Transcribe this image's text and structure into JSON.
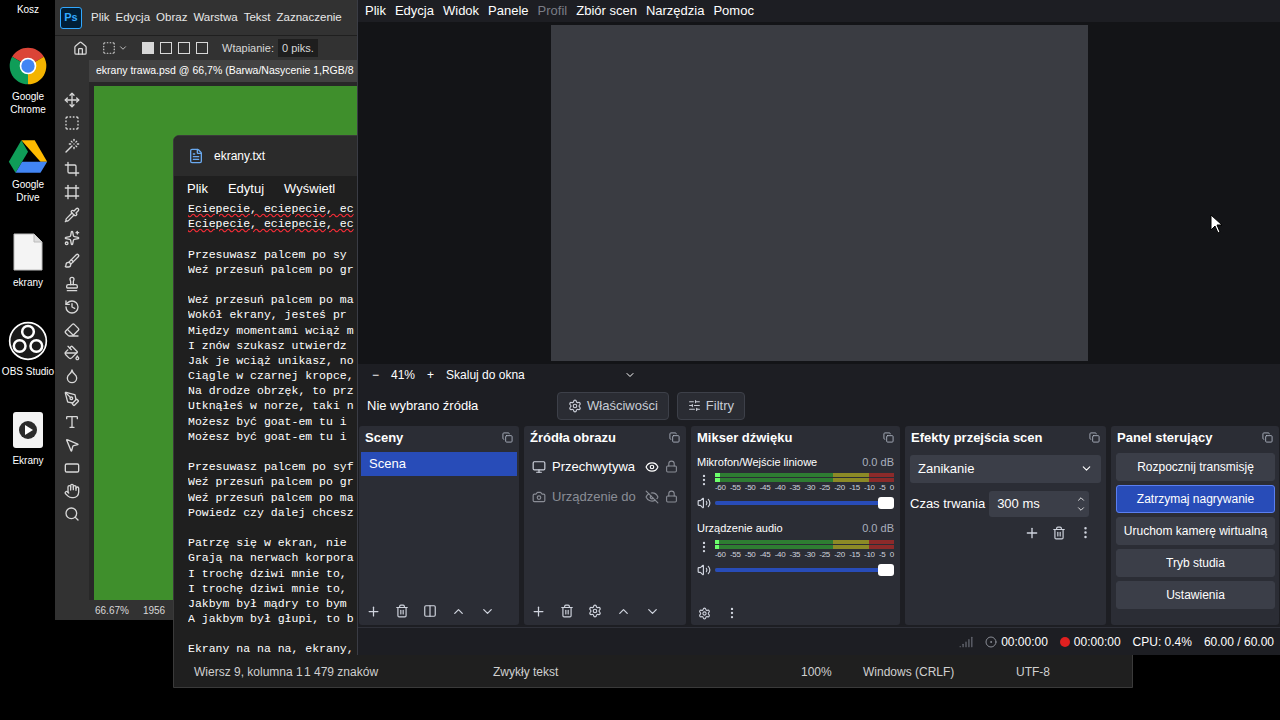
{
  "desktop": {
    "icons": [
      {
        "label": "Kosz"
      },
      {
        "label": "Google Chrome"
      },
      {
        "label": "Google Drive"
      },
      {
        "label": "ekrany"
      },
      {
        "label": "OBS Studio"
      },
      {
        "label": "Ekrany"
      }
    ]
  },
  "photoshop": {
    "logo": "Ps",
    "menu": [
      "Plik",
      "Edycja",
      "Obraz",
      "Warstwa",
      "Tekst",
      "Zaznaczenie"
    ],
    "options": {
      "feather_label": "Wtapianie:",
      "feather_value": "0 piks."
    },
    "document_tab": "ekrany trawa.psd @ 66,7% (Barwa/Nasycenie 1,RGB/8",
    "status": {
      "zoom": "66.67%",
      "size": "1956"
    }
  },
  "notepad": {
    "title": "ekrany.txt",
    "menu": [
      "Plik",
      "Edytuj",
      "Wyświetl"
    ],
    "lines": [
      {
        "text": "Eciepecie, eciepecie, ec",
        "misspelled": true
      },
      {
        "text": "Eciepecie, eciepecie, ec",
        "misspelled": true
      },
      {
        "text": "",
        "misspelled": false
      },
      {
        "text": "Przesuwasz palcem po sy",
        "misspelled": false
      },
      {
        "text": "Weź przesuń palcem po gr",
        "misspelled": false
      },
      {
        "text": "",
        "misspelled": false
      },
      {
        "text": "Weź przesuń palcem po ma",
        "misspelled": false
      },
      {
        "text": "Wokół ekrany, jesteś pr",
        "misspelled": false
      },
      {
        "text": "Między momentami wciąż m",
        "misspelled": false
      },
      {
        "text": "I znów szukasz utwierdz",
        "misspelled": false
      },
      {
        "text": "Jak je wciąż unikasz, no",
        "misspelled": false
      },
      {
        "text": "Ciągle w czarnej kropce,",
        "misspelled": false
      },
      {
        "text": "Na drodze obrzęk, to prz",
        "misspelled": false
      },
      {
        "text": "Utknąłeś w norze, taki n",
        "misspelled": false
      },
      {
        "text": "Możesz być goat-em tu i",
        "misspelled": false
      },
      {
        "text": "Możesz być goat-em tu i",
        "misspelled": false
      },
      {
        "text": "",
        "misspelled": false
      },
      {
        "text": "Przesuwasz palcem po syf",
        "misspelled": false
      },
      {
        "text": "Weź przesuń palcem po gr",
        "misspelled": false
      },
      {
        "text": "Weź przesuń palcem po ma",
        "misspelled": false
      },
      {
        "text": "Powiedz czy dalej chcesz",
        "misspelled": false
      },
      {
        "text": "",
        "misspelled": false
      },
      {
        "text": "Patrzę się w ekran, nie",
        "misspelled": false
      },
      {
        "text": "Grają na nerwach korpora",
        "misspelled": false
      },
      {
        "text": "I trochę dziwi mnie to,",
        "misspelled": false
      },
      {
        "text": "I trochę dziwi mnie to,",
        "misspelled": false
      },
      {
        "text": "Jakbym był mądry to bym",
        "misspelled": false
      },
      {
        "text": "A jakbym był głupi, to b",
        "misspelled": false
      },
      {
        "text": "",
        "misspelled": false
      },
      {
        "text": "Ekrany na na na, ekrany,",
        "misspelled": false
      }
    ],
    "status_bar": [
      "Wiersz 9, kolumna 1",
      "1 479 znaków",
      "Zwykły tekst",
      "100%",
      "Windows (CRLF)",
      "UTF-8"
    ]
  },
  "obs": {
    "menu": [
      {
        "label": "Plik",
        "disabled": false
      },
      {
        "label": "Edycja",
        "disabled": false
      },
      {
        "label": "Widok",
        "disabled": false
      },
      {
        "label": "Panele",
        "disabled": false
      },
      {
        "label": "Profil",
        "disabled": true
      },
      {
        "label": "Zbiór scen",
        "disabled": false
      },
      {
        "label": "Narzędzia",
        "disabled": false
      },
      {
        "label": "Pomoc",
        "disabled": false
      }
    ],
    "zoom_bar": {
      "minus": "−",
      "value": "41%",
      "plus": "+",
      "scale": "Skaluj do okna"
    },
    "source_bar": {
      "label": "Nie wybrano źródła",
      "buttons": [
        "Właściwości",
        "Filtry"
      ]
    },
    "scenes": {
      "title": "Sceny",
      "items": [
        {
          "label": "Scena",
          "selected": true
        }
      ]
    },
    "sources": {
      "title": "Źródła obrazu",
      "items": [
        {
          "label": "Przechwytywa",
          "visible": true,
          "kind": "screen"
        },
        {
          "label": "Urządzenie do",
          "visible": false,
          "kind": "camera"
        }
      ]
    },
    "mixer": {
      "title": "Mikser dźwięku",
      "scale": [
        "-60",
        "-55",
        "-50",
        "-45",
        "-40",
        "-35",
        "-30",
        "-25",
        "-20",
        "-15",
        "-10",
        "-5",
        "0"
      ],
      "channels": [
        {
          "name": "Mikrofon/Wejście liniowe",
          "reading": "0.0 dB",
          "meter": {
            "level": 0.03
          },
          "volume": {
            "level": 1
          }
        },
        {
          "name": "Urządzenie audio",
          "reading": "0.0 dB",
          "meter": {
            "level": 0.02
          },
          "volume": {
            "level": 1
          }
        }
      ]
    },
    "transitions": {
      "title": "Efekty przejścia scen",
      "selected": "Zanikanie",
      "duration_label": "Czas trwania",
      "duration": "300 ms"
    },
    "controls": {
      "title": "Panel sterujący",
      "buttons": [
        {
          "label": "Rozpocznij transmisję",
          "selected": false
        },
        {
          "label": "Zatrzymaj nagrywanie",
          "selected": true
        },
        {
          "label": "Uruchom kamerę wirtualną",
          "selected": false
        },
        {
          "label": "Tryb studia",
          "selected": false
        },
        {
          "label": "Ustawienia",
          "selected": false
        }
      ]
    },
    "status_bar": {
      "stream_time": "00:00:00",
      "record_time": "00:00:00",
      "cpu": "CPU: 0.4%",
      "fps": "60.00 / 60.00"
    }
  }
}
